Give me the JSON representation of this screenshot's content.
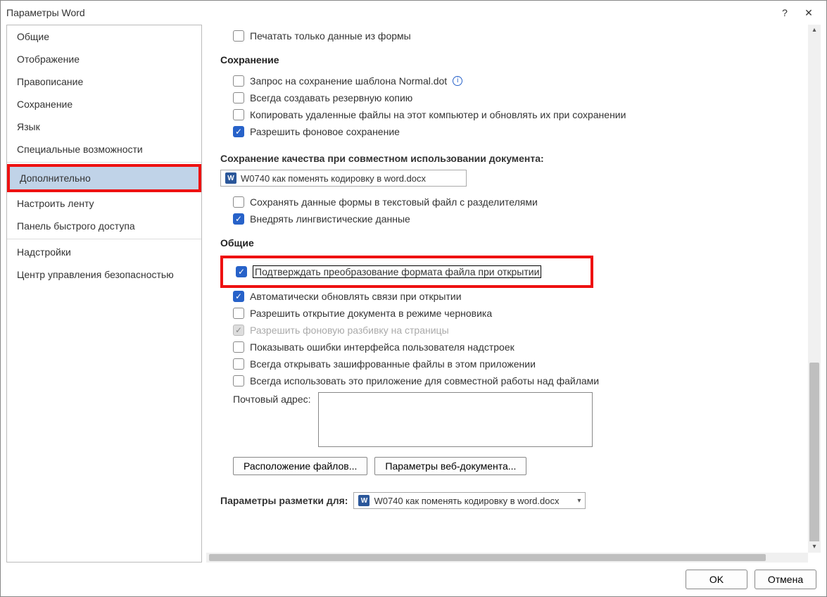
{
  "titlebar": {
    "title": "Параметры Word",
    "help": "?",
    "close": "✕"
  },
  "sidebar": {
    "items": [
      {
        "label": "Общие"
      },
      {
        "label": "Отображение"
      },
      {
        "label": "Правописание"
      },
      {
        "label": "Сохранение"
      },
      {
        "label": "Язык"
      },
      {
        "label": "Специальные возможности"
      },
      {
        "label": "Дополнительно",
        "selected": true,
        "highlight": true
      },
      {
        "label": "Настроить ленту"
      },
      {
        "label": "Панель быстрого доступа"
      },
      {
        "label": "Надстройки"
      },
      {
        "label": "Центр управления безопасностью"
      }
    ]
  },
  "content": {
    "print_form_only": "Печатать только данные из формы",
    "sec_save": "Сохранение",
    "chk_prompt_normal": "Запрос на сохранение шаблона Normal.dot",
    "chk_backup": "Всегда создавать резервную копию",
    "chk_copy_remote": "Копировать удаленные файлы на этот компьютер и обновлять их при сохранении",
    "chk_bg_save": "Разрешить фоновое сохранение",
    "sec_share_title": "Сохранение качества при совместном использовании документа:",
    "share_doc": "W0740 как поменять кодировку в word.docx",
    "chk_form_text": "Сохранять данные формы в текстовый файл с разделителями",
    "chk_ling": "Внедрять лингвистические данные",
    "sec_general": "Общие",
    "chk_confirm_conv": "Подтверждать преобразование формата файла при открытии",
    "chk_auto_links": "Автоматически обновлять связи при открытии",
    "chk_draft": "Разрешить открытие документа в режиме черновика",
    "chk_bg_pagination": "Разрешить фоновую разбивку на страницы",
    "chk_addin_errors": "Показывать ошибки интерфейса пользователя надстроек",
    "chk_encrypted": "Всегда открывать зашифрованные файлы в этом приложении",
    "chk_coauth": "Всегда использовать это приложение для совместной работы над файлами",
    "mail_label": "Почтовый адрес:",
    "btn_file_loc": "Расположение файлов...",
    "btn_web_opts": "Параметры веб-документа...",
    "sec_layout_title": "Параметры разметки для:",
    "layout_doc": "W0740 как поменять кодировку в word.docx"
  },
  "footer": {
    "ok": "OK",
    "cancel": "Отмена"
  }
}
